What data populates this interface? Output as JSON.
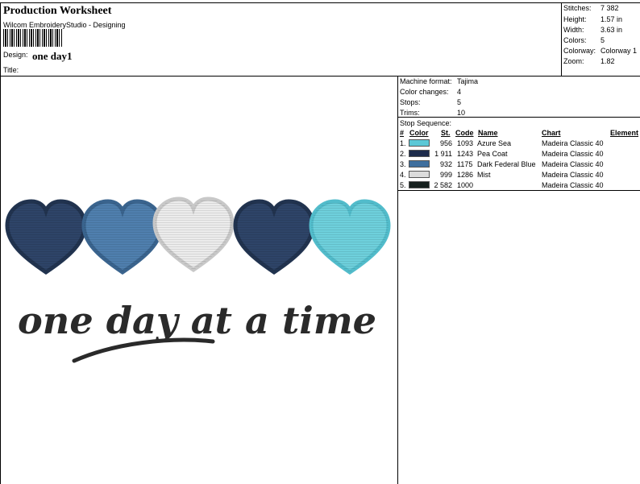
{
  "header": {
    "title": "Production Worksheet",
    "software": "Wilcom EmbroideryStudio - Designing",
    "design_label": "Design:",
    "design_name": "one day1",
    "title_label": "Title:"
  },
  "stats": [
    {
      "label": "Stitches:",
      "value": "7 382"
    },
    {
      "label": "Height:",
      "value": "1.57 in"
    },
    {
      "label": "Width:",
      "value": "3.63 in"
    },
    {
      "label": "Colors:",
      "value": "5"
    },
    {
      "label": "Colorway:",
      "value": "Colorway 1"
    },
    {
      "label": "Zoom:",
      "value": "1.82"
    }
  ],
  "machine": [
    {
      "label": "Machine format:",
      "value": "Tajima"
    },
    {
      "label": "Color changes:",
      "value": "4"
    },
    {
      "label": "Stops:",
      "value": "5"
    },
    {
      "label": "Trims:",
      "value": "10"
    }
  ],
  "stop_sequence": {
    "label": "Stop Sequence:",
    "headers": {
      "num": "#",
      "color": "Color",
      "st": "St.",
      "code": "Code",
      "name": "Name",
      "chart": "Chart",
      "element": "Element"
    },
    "rows": [
      {
        "num": "1.",
        "color": "#5bc8d6",
        "st": "956",
        "code": "1093",
        "name": "Azure Sea",
        "chart": "Madeira Classic 40"
      },
      {
        "num": "2.",
        "color": "#1e2c4c",
        "st": "1 911",
        "code": "1243",
        "name": "Pea Coat",
        "chart": "Madeira Classic 40"
      },
      {
        "num": "3.",
        "color": "#3f6f9e",
        "st": "932",
        "code": "1175",
        "name": "Dark Federal Blue",
        "chart": "Madeira Classic 40"
      },
      {
        "num": "4.",
        "color": "#dcdcdc",
        "st": "999",
        "code": "1286",
        "name": "Mist",
        "chart": "Madeira Classic 40"
      },
      {
        "num": "5.",
        "color": "#16201e",
        "st": "2 582",
        "code": "1000",
        "name": "",
        "chart": "Madeira Classic 40"
      }
    ]
  },
  "design_text": "one day at a time",
  "hearts": [
    {
      "color": "#2e4468"
    },
    {
      "color": "#4f7fae"
    },
    {
      "color": "#ececec"
    },
    {
      "color": "#2e4468"
    },
    {
      "color": "#6ed0dc"
    }
  ]
}
